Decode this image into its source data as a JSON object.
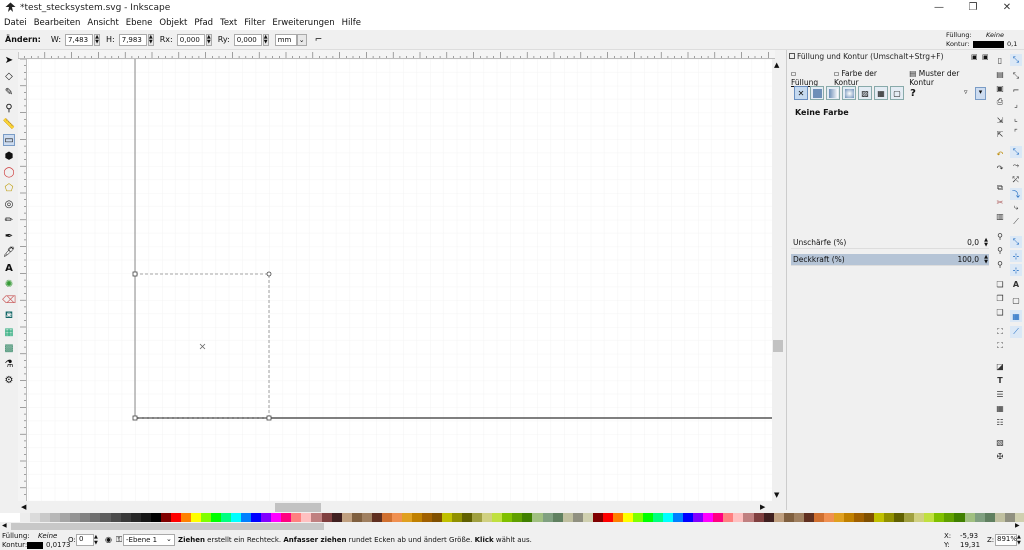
{
  "window": {
    "title": "*test_stecksystem.svg - Inkscape",
    "minimize": "—",
    "maximize": "❐",
    "close": "✕"
  },
  "menu": [
    "Datei",
    "Bearbeiten",
    "Ansicht",
    "Ebene",
    "Objekt",
    "Pfad",
    "Text",
    "Filter",
    "Erweiterungen",
    "Hilfe"
  ],
  "toolcontrols": {
    "label": "Ändern:",
    "w_label": "W:",
    "w_value": "7,483",
    "h_label": "H:",
    "h_value": "7,983",
    "rx_label": "Rx:",
    "rx_value": "0,000",
    "ry_label": "Ry:",
    "ry_value": "0,000",
    "unit": "mm"
  },
  "style_indicator": {
    "fill_label": "Füllung:",
    "fill_value": "Keine",
    "stroke_label": "Kontur:",
    "stroke_width": "0,1"
  },
  "dock": {
    "title": "Füllung und Kontur (Umschalt+Strg+F)",
    "tabs": [
      "Füllung",
      "Farbe der Kontur",
      "Muster der Kontur"
    ],
    "paint_unknown": "?",
    "no_color": "Keine Farbe",
    "blur_label": "Unschärfe (%)",
    "blur_value": "0,0",
    "opacity_label": "Deckkraft (%)",
    "opacity_value": "100,0"
  },
  "status": {
    "fill_label": "Füllung:",
    "fill_value": "Keine",
    "stroke_label": "Kontur:",
    "stroke_width": "0,0173",
    "o_label": "O:",
    "o_value": "0",
    "layer": "-Ebene 1",
    "msg_b1": "Ziehen",
    "msg_t1": " erstellt ein Rechteck. ",
    "msg_b2": "Anfasser ziehen",
    "msg_t2": " rundet Ecken ab und ändert Größe. ",
    "msg_b3": "Klick",
    "msg_t3": " wählt aus.",
    "x_label": "X:",
    "x_value": "-5,93",
    "y_label": "Y:",
    "y_value": "19,31",
    "z_label": "Z:",
    "zoom": "891%"
  },
  "colors": {
    "accent": "#1565c0",
    "canvas": "#ffffff",
    "grid": "#e6e6e6"
  }
}
